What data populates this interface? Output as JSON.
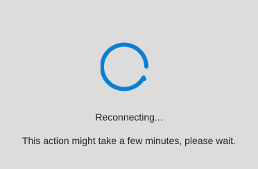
{
  "dialog": {
    "status_text": "Reconnecting...",
    "message": "This action might take a few minutes, please wait."
  },
  "spinner": {
    "icon": "loading-spinner-icon",
    "color": "#0a7fd6"
  },
  "colors": {
    "background": "#dcdcdc",
    "text": "#222222",
    "accent": "#0a7fd6"
  }
}
